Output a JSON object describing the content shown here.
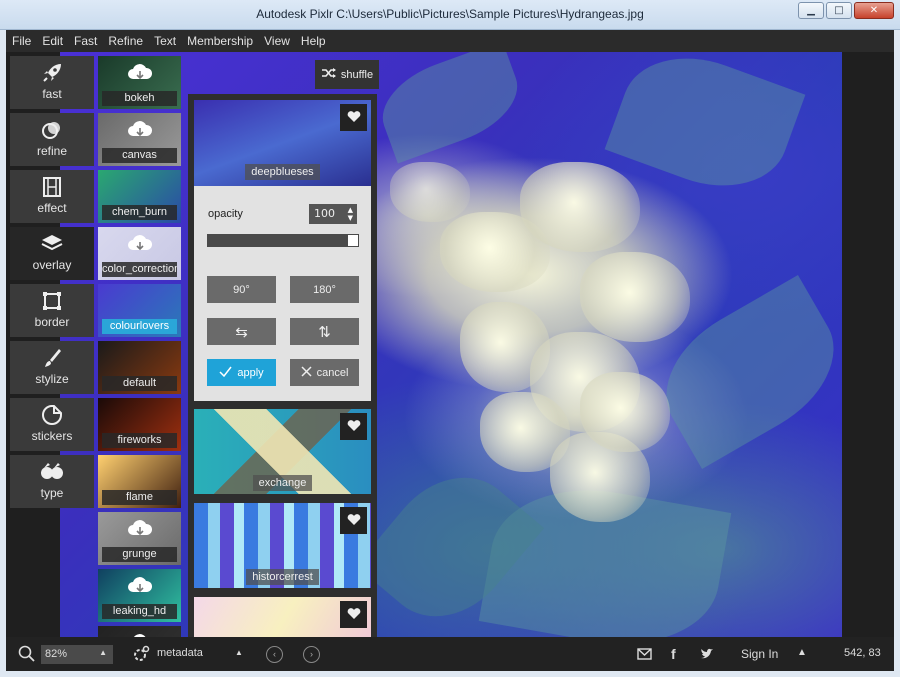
{
  "window": {
    "title": "Autodesk Pixlr      C:\\Users\\Public\\Pictures\\Sample Pictures\\Hydrangeas.jpg",
    "minimize": "▁",
    "maximize": "□",
    "close": "✕"
  },
  "menu": [
    "File",
    "Edit",
    "Fast",
    "Refine",
    "Text",
    "Membership",
    "View",
    "Help"
  ],
  "tools": [
    {
      "label": "fast",
      "icon": "rocket-icon"
    },
    {
      "label": "refine",
      "icon": "refine-circles-icon"
    },
    {
      "label": "effect",
      "icon": "film-icon"
    },
    {
      "label": "overlay",
      "icon": "layers-icon"
    },
    {
      "label": "border",
      "icon": "border-frame-icon"
    },
    {
      "label": "stylize",
      "icon": "brush-icon"
    },
    {
      "label": "stickers",
      "icon": "sticker-icon"
    },
    {
      "label": "type",
      "icon": "quote-icon"
    }
  ],
  "overlays": [
    {
      "label": "bokeh",
      "colors": [
        "#1a3a2a",
        "#3a6e50"
      ],
      "download": true
    },
    {
      "label": "canvas",
      "colors": [
        "#6a6a6a",
        "#9a9a9a"
      ],
      "download": true
    },
    {
      "label": "chem_burn",
      "colors": [
        "#2aa870",
        "#2a4aa8"
      ],
      "download": false
    },
    {
      "label": "color_correction",
      "colors": [
        "#d8d8ee",
        "#c8c8e4"
      ],
      "download": true
    },
    {
      "label": "colourlovers",
      "colors": [
        "#4a3ad0",
        "#2a7ab8"
      ],
      "download": false,
      "selected": true
    },
    {
      "label": "default",
      "colors": [
        "#1a1a1a",
        "#8a3a10"
      ],
      "download": false
    },
    {
      "label": "fireworks",
      "colors": [
        "#1a0a08",
        "#a03010"
      ],
      "download": false
    },
    {
      "label": "flame",
      "colors": [
        "#ffd070",
        "#402010"
      ],
      "download": false
    },
    {
      "label": "grunge",
      "colors": [
        "#9a9a9a",
        "#6a6a6a"
      ],
      "download": true
    },
    {
      "label": "leaking_hd",
      "colors": [
        "#104060",
        "#30c0a0"
      ],
      "download": true
    },
    {
      "label": "",
      "colors": [
        "#222",
        "#333"
      ],
      "download": true
    }
  ],
  "panel": {
    "shuffle_label": "shuffle",
    "cards": [
      {
        "label": "deepblueses"
      },
      {
        "label": "exchange"
      },
      {
        "label": "historcerrest"
      },
      {
        "label": ""
      }
    ],
    "opacity_label": "opacity",
    "opacity_value": "100",
    "rotate_90": "90°",
    "rotate_180": "180°",
    "flip_h": "⇆",
    "flip_v": "⇅",
    "apply": "apply",
    "cancel": "cancel"
  },
  "status": {
    "zoom": "82%",
    "metadata": "metadata",
    "sign_in": "Sign In",
    "coords": "542, 83"
  }
}
